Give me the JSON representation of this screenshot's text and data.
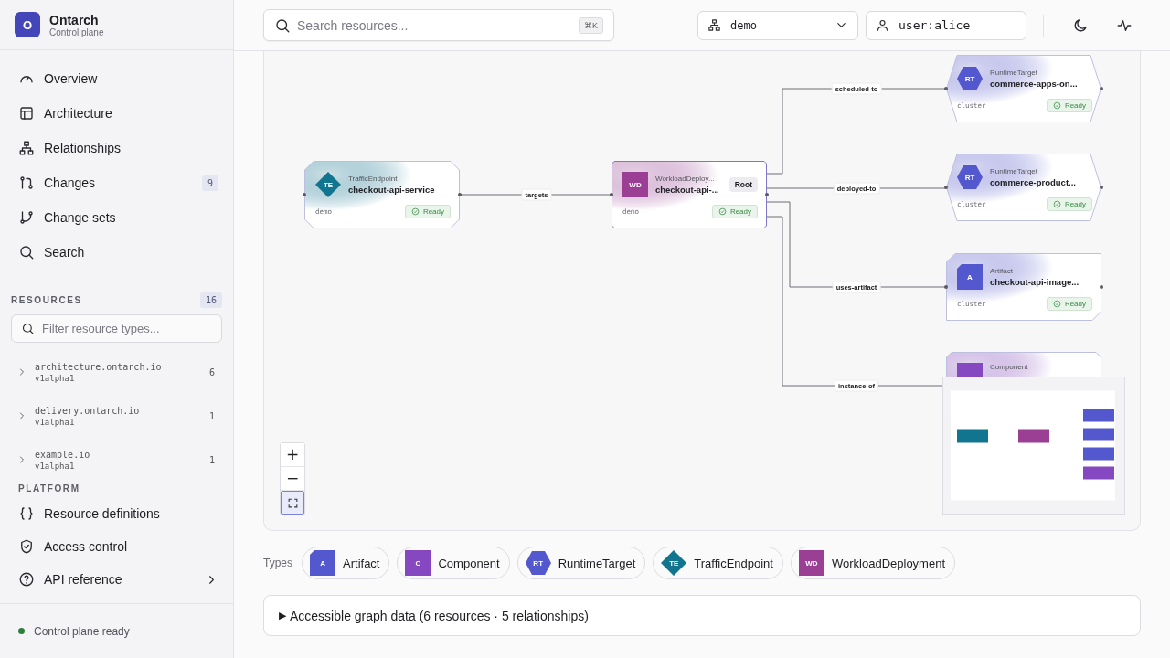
{
  "app": {
    "logo": "O",
    "name": "Ontarch",
    "subtitle": "Control plane"
  },
  "nav": [
    {
      "label": "Overview"
    },
    {
      "label": "Architecture"
    },
    {
      "label": "Relationships"
    },
    {
      "label": "Changes",
      "badge": "9"
    },
    {
      "label": "Change sets"
    },
    {
      "label": "Search"
    }
  ],
  "resources": {
    "title": "RESOURCES",
    "count": "16",
    "filter_placeholder": "Filter resource types...",
    "groups": [
      {
        "name": "architecture.ontarch.io",
        "version": "v1alpha1",
        "count": "6",
        "expanded": false
      },
      {
        "name": "delivery.ontarch.io",
        "version": "v1alpha1",
        "count": "1",
        "expanded": false
      },
      {
        "name": "example.io",
        "version": "v1alpha1",
        "count": "1",
        "expanded": false
      }
    ]
  },
  "platform": {
    "title": "PLATFORM",
    "items": [
      {
        "label": "Resource definitions",
        "submenu": false
      },
      {
        "label": "Access control",
        "submenu": false
      },
      {
        "label": "API reference",
        "submenu": true
      }
    ]
  },
  "status": {
    "text": "Control plane ready",
    "online": true
  },
  "header": {
    "search_placeholder": "Search resources...",
    "shortcut": "⌘K",
    "namespace": "demo",
    "user": "user:alice"
  },
  "graph": {
    "nodes": [
      {
        "kind": "te",
        "badge": "TE",
        "type": "TrafficEndpoint",
        "name": "checkout-api-service",
        "scope": "demo",
        "status": "Ready"
      },
      {
        "kind": "wd",
        "badge": "WD",
        "type": "WorkloadDeploy...",
        "name": "checkout-api-...",
        "scope": "demo",
        "status": "Ready",
        "tag": "Root"
      },
      {
        "kind": "rt",
        "badge": "RT",
        "type": "RuntimeTarget",
        "name": "commerce-apps-on...",
        "scope": "cluster",
        "status": "Ready"
      },
      {
        "kind": "rt",
        "badge": "RT",
        "type": "RuntimeTarget",
        "name": "commerce-product...",
        "scope": "cluster",
        "status": "Ready"
      },
      {
        "kind": "a",
        "badge": "A",
        "type": "Artifact",
        "name": "checkout-api-image...",
        "scope": "cluster",
        "status": "Ready"
      },
      {
        "kind": "c",
        "type": "Component"
      }
    ],
    "edges": [
      {
        "label": "targets"
      },
      {
        "label": "scheduled-to"
      },
      {
        "label": "deployed-to"
      },
      {
        "label": "uses-artifact"
      },
      {
        "label": "instance-of"
      }
    ],
    "zoom_controls": [
      {
        "label": "+"
      },
      {
        "label": "−"
      }
    ]
  },
  "types": {
    "title": "Types",
    "items": [
      {
        "kind": "a",
        "badge": "A",
        "label": "Artifact",
        "color": "#5458cf"
      },
      {
        "kind": "c",
        "badge": "C",
        "label": "Component",
        "color": "#8648c0"
      },
      {
        "kind": "rt",
        "badge": "RT",
        "label": "RuntimeTarget",
        "color": "#5458cf"
      },
      {
        "kind": "te",
        "badge": "TE",
        "label": "TrafficEndpoint",
        "color": "#117590"
      },
      {
        "kind": "wd",
        "badge": "WD",
        "label": "WorkloadDeployment",
        "color": "#9b3f95"
      }
    ]
  },
  "graph_data": {
    "toggle": "▶",
    "text": "Accessible graph data (6 resources · 5 relationships)"
  }
}
